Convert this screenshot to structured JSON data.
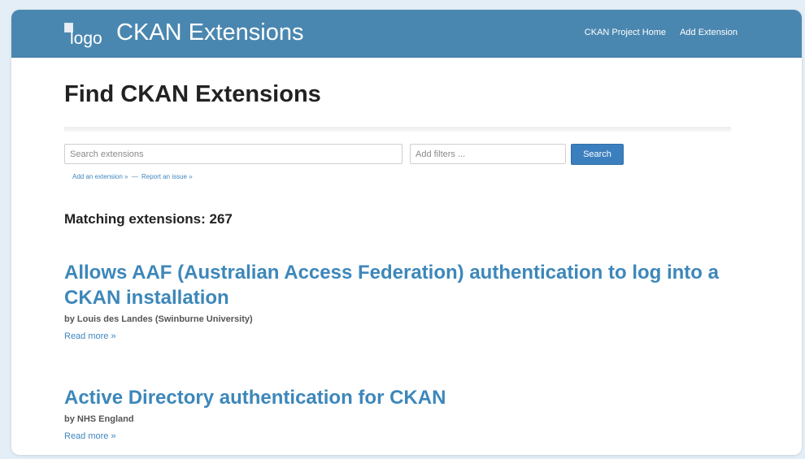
{
  "navbar": {
    "logo_alt": "logo",
    "title": "CKAN Extensions",
    "links": [
      "CKAN Project Home",
      "Add Extension"
    ]
  },
  "page": {
    "heading": "Find CKAN Extensions"
  },
  "search": {
    "placeholder": "Search extensions",
    "filter_placeholder": "Add filters ...",
    "button_label": "Search"
  },
  "sublinks": {
    "add": "Add an extension »",
    "dash": "—",
    "report": "Report an issue »"
  },
  "results": {
    "count_text": "Matching extensions: 267",
    "items": [
      {
        "title": "Allows AAF (Australian Access Federation) authentication to log into a CKAN installation",
        "author": "by Louis des Landes (Swinburne University)",
        "read_more": "Read more »"
      },
      {
        "title": "Active Directory authentication for CKAN",
        "author": "by NHS England",
        "read_more": "Read more »"
      }
    ]
  }
}
